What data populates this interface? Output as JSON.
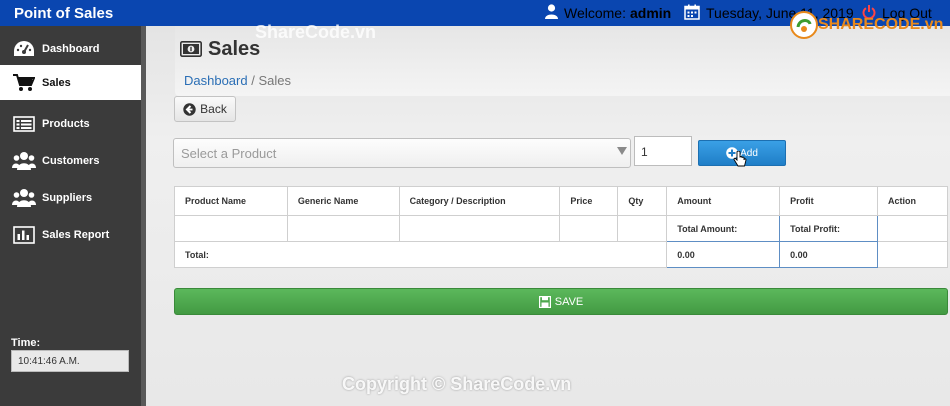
{
  "app": {
    "title": "Point of Sales"
  },
  "topbar": {
    "welcome_prefix": "Welcome:",
    "user": "admin",
    "date": "Tuesday, June 11, 2019",
    "logout": "Log Out"
  },
  "sidebar": {
    "items": [
      {
        "label": "Dashboard",
        "icon": "dashboard-icon",
        "active": false
      },
      {
        "label": "Sales",
        "icon": "cart-icon",
        "active": true
      },
      {
        "label": "Products",
        "icon": "list-icon",
        "active": false
      },
      {
        "label": "Customers",
        "icon": "users-icon",
        "active": false
      },
      {
        "label": "Suppliers",
        "icon": "group-icon",
        "active": false
      },
      {
        "label": "Sales Report",
        "icon": "bar-chart-icon",
        "active": false
      }
    ],
    "time_label": "Time:",
    "time_value": "10:41:46 A.M."
  },
  "page": {
    "title": "Sales",
    "breadcrumb_home": "Dashboard",
    "breadcrumb_sep": "/",
    "breadcrumb_current": "Sales",
    "back_label": "Back"
  },
  "form": {
    "product_placeholder": "Select a Product",
    "qty_value": "1",
    "add_label": "Add"
  },
  "table": {
    "headers": [
      "Product Name",
      "Generic Name",
      "Category / Description",
      "Price",
      "Qty",
      "Amount",
      "Profit",
      "Action"
    ],
    "total_amount_label": "Total Amount:",
    "total_profit_label": "Total Profit:",
    "total_label": "Total:",
    "total_amount": "0.00",
    "total_profit": "0.00"
  },
  "save_label": "SAVE",
  "watermark": {
    "top": "ShareCode.vn",
    "bottom": "Copyright © ShareCode.vn",
    "logo_a": "SHARE",
    "logo_b": "CODE.vn"
  },
  "colors": {
    "topbar": "#0a46b0",
    "sidebar": "#3b3b3b",
    "add": "#2b8fd7",
    "save": "#4fae4f"
  }
}
